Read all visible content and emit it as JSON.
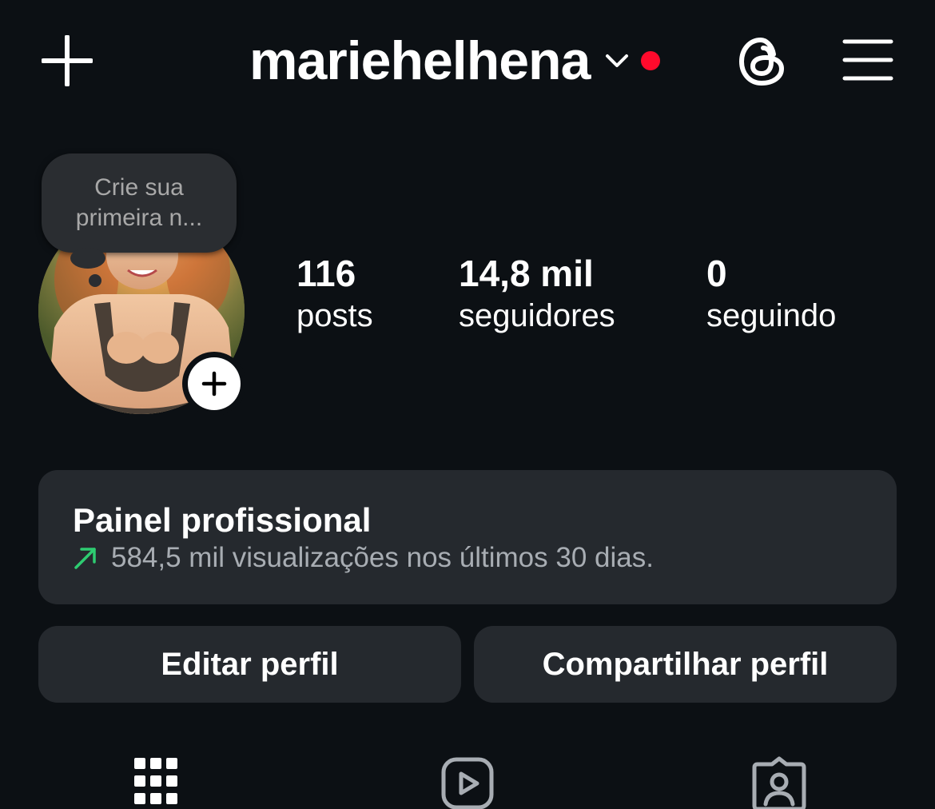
{
  "header": {
    "username": "mariehelhena",
    "notification_dot_color": "#ff0a2c",
    "icons": [
      "plus-icon",
      "chevron-down-icon",
      "threads-icon",
      "hamburger-menu-icon"
    ]
  },
  "note": {
    "text": "Crie sua primeira n..."
  },
  "stats": {
    "posts": {
      "value": "116",
      "label": "posts"
    },
    "followers": {
      "value": "14,8 mil",
      "label": "seguidores"
    },
    "following": {
      "value": "0",
      "label": "seguindo"
    }
  },
  "dashboard": {
    "title": "Painel profissional",
    "subtitle": "584,5 mil visualizações nos últimos 30 dias.",
    "trend_color": "#2ecc71"
  },
  "actions": {
    "edit_label": "Editar perfil",
    "share_label": "Compartilhar perfil"
  },
  "tabs": [
    "grid-icon",
    "reels-icon",
    "tagged-icon"
  ]
}
